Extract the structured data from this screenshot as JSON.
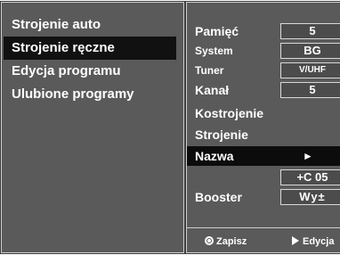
{
  "left_menu": {
    "items": [
      {
        "label": "Strojenie auto"
      },
      {
        "label": "Strojenie ręczne"
      },
      {
        "label": "Edycja programu"
      },
      {
        "label": "Ulubione programy"
      }
    ],
    "selected_index": 1
  },
  "right_menu": {
    "memory": {
      "label": "Pamięć",
      "value": "5"
    },
    "system": {
      "label": "System",
      "value": "BG"
    },
    "tuner": {
      "label": "Tuner",
      "value": "V/UHF"
    },
    "channel": {
      "label": "Kanał",
      "value": "5"
    },
    "fine_tune": {
      "label": "Kostrojenie"
    },
    "search": {
      "label": "Strojenie"
    },
    "name": {
      "label": "Nazwa",
      "arrow": "►"
    },
    "name_value": {
      "value": "+C 05"
    },
    "booster": {
      "label": "Booster",
      "value": "Wy±"
    }
  },
  "footer": {
    "save_label": "Zapisz",
    "edit_label": "Edycja",
    "save_icon": "ok-circle-icon",
    "edit_icon": "right-triangle-icon"
  },
  "colors": {
    "panel_bg": "#5a5a5a",
    "selected_bg": "#111111",
    "text": "#ffffff"
  }
}
